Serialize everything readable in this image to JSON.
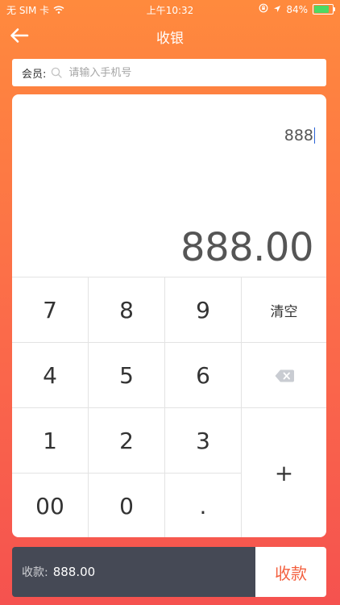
{
  "status_bar": {
    "carrier": "无 SIM 卡",
    "time": "上午10:32",
    "battery_percent": "84%",
    "battery_level": 0.84,
    "battery_color": "#4cd964"
  },
  "nav": {
    "title": "收银",
    "back_icon": "arrow-left-icon"
  },
  "member": {
    "label": "会员:",
    "placeholder": "请输入手机号",
    "value": ""
  },
  "display": {
    "expression": "888",
    "result": "888.00"
  },
  "keypad": {
    "keys": [
      "7",
      "8",
      "9",
      "清空",
      "4",
      "5",
      "6",
      "",
      "1",
      "2",
      "3",
      "+",
      "00",
      "0",
      "."
    ],
    "backspace_icon": "backspace-icon"
  },
  "footer": {
    "amount_label": "收款:",
    "amount_value": "888.00",
    "pay_label": "收款"
  },
  "colors": {
    "accent": "#f3603f",
    "footer_bg": "#454955",
    "gradient_top": "#ff8a3d",
    "gradient_bottom": "#f5524f"
  }
}
